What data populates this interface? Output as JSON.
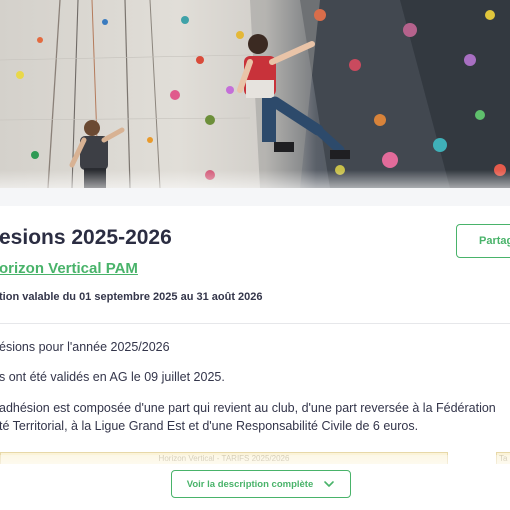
{
  "hero": {
    "image_description_icon": "climbing-wall-photo"
  },
  "header": {
    "title": "esions 2025-2026",
    "organization": "orizon Vertical PAM",
    "validity": "tion valable du 01 septembre 2025 au 31 août 2026"
  },
  "actions": {
    "share_label": "Partag"
  },
  "description": {
    "line1": "ésions pour l'année 2025/2026",
    "line2": "s ont été validés en AG le 09 juillet 2025.",
    "line3": "adhésion est composée d'une part qui revient au club, d'une part reversée à la Fédération",
    "line4": "té Territorial, à la Ligue Grand Est et d'une Responsabilité Civile de 6 euros."
  },
  "tarif_table": {
    "caption": "Horizon Vertical - TARIFS 2025/2026",
    "caption_right": "Ta"
  },
  "footer": {
    "more_label": "Voir la description complète"
  },
  "colors": {
    "accent": "#49b36a",
    "title": "#2b2d42"
  }
}
